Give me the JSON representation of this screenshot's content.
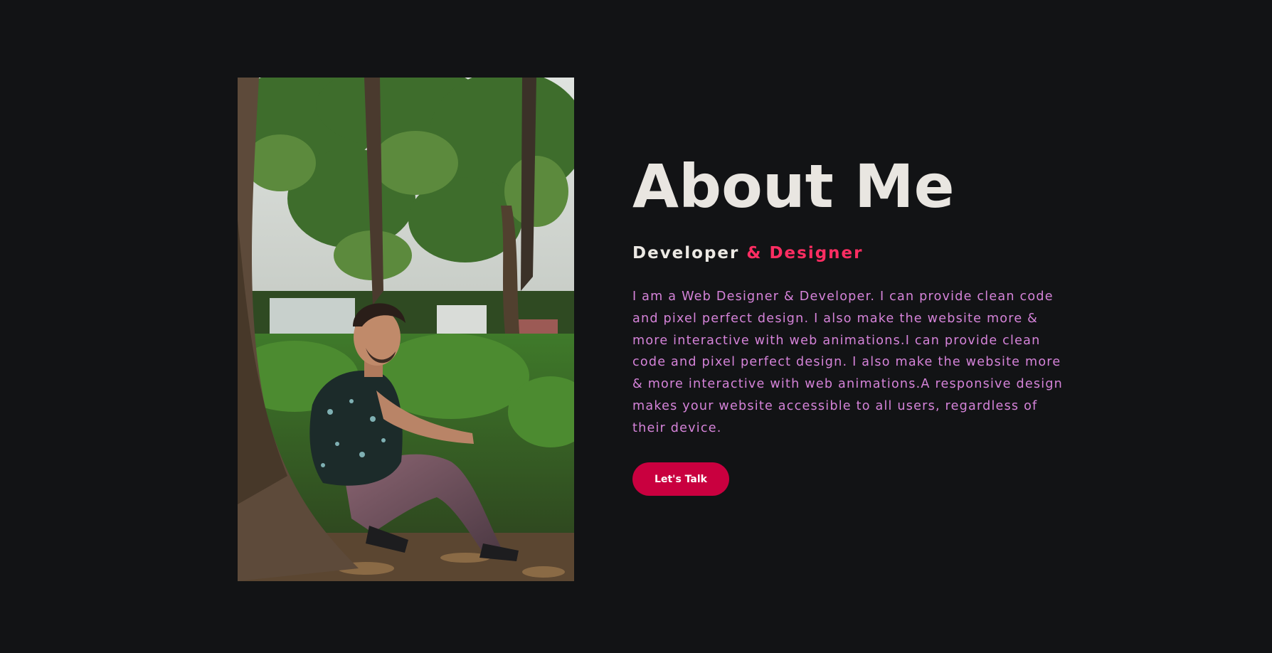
{
  "about": {
    "title": "About Me",
    "subtitle_part1": "Developer",
    "subtitle_part2": " & Designer",
    "description": "I am a Web Designer & Developer. I can provide clean code and pixel perfect design. I also make the website more & more interactive with web animations.I can provide clean code and pixel perfect design. I also make the website more & more interactive with web animations.A responsive design makes your website accessible to all users, regardless of their device.",
    "cta_label": "Let's Talk"
  },
  "photo": {
    "subject": "man sitting against a tree in a forest"
  },
  "colors": {
    "background": "#121315",
    "title": "#e9e6e1",
    "accent": "#ff2d62",
    "body_text": "#d583d9",
    "button": "#c9003f"
  }
}
